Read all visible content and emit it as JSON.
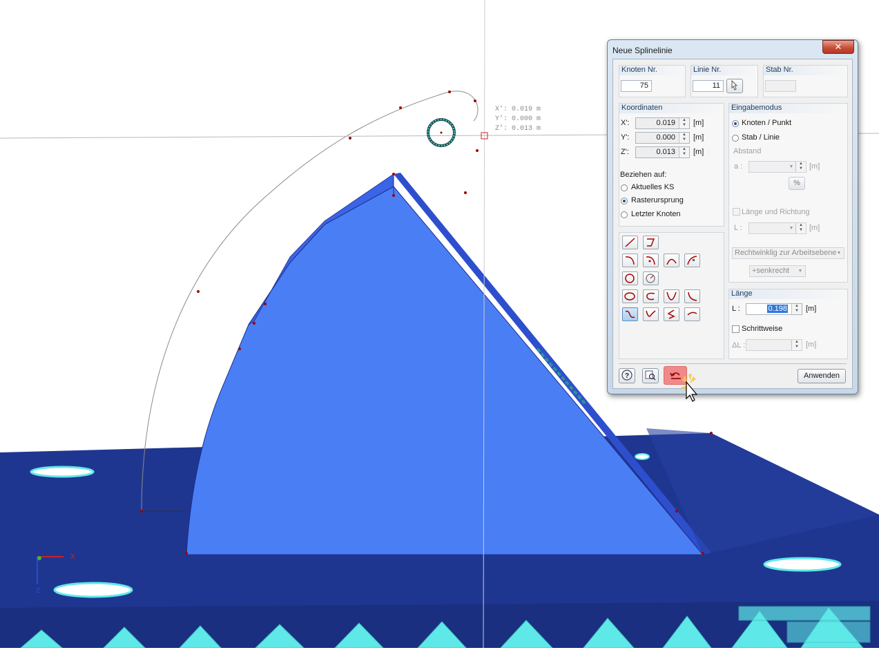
{
  "viewport": {
    "coord_readout": [
      "X': 0.019 m",
      "Y': 0.000 m",
      "Z': 0.013 m"
    ],
    "axis_x_label": "X",
    "axis_z_label": "Z"
  },
  "dialog": {
    "title": "Neue Splinelinie",
    "close_label": "✕",
    "node": {
      "header": "Knoten Nr.",
      "value": "75"
    },
    "line": {
      "header": "Linie Nr.",
      "value": "11"
    },
    "member": {
      "header": "Stab Nr.",
      "value": ""
    },
    "coordinates": {
      "header": "Koordinaten",
      "x_label": "X':",
      "x_value": "0.019",
      "y_label": "Y':",
      "y_value": "0.000",
      "z_label": "Z':",
      "z_value": "0.013",
      "unit": "[m]",
      "relate_label": "Beziehen auf:",
      "options": [
        "Aktuelles KS",
        "Rasterursprung",
        "Letzter Knoten"
      ],
      "selected": "Rasterursprung"
    },
    "input_mode": {
      "header": "Eingabemodus",
      "options": [
        "Knoten / Punkt",
        "Stab / Linie"
      ],
      "selected": "Knoten / Punkt",
      "distance_label": "Abstand",
      "a_label": "a :",
      "a_unit": "[m]",
      "percent_label": "%",
      "length_direction_label": "Länge und Richtung",
      "l_label": "L :",
      "l_unit": "[m]",
      "perpendicular_option": "Rechtwinklig zur Arbeitsebene",
      "direction_option": "+senkrecht"
    },
    "length": {
      "header": "Länge",
      "l_label": "L :",
      "l_value": "0.198",
      "unit": "[m]",
      "stepwise_label": "Schrittweise",
      "delta_label": "ΔL :",
      "delta_unit": "[m]"
    },
    "apply_label": "Anwenden"
  },
  "colors": {
    "plate": "#1f3691",
    "solid_face": "#4a7ef5",
    "solid_top": "#2f4fce",
    "support": "#5fe8e8",
    "dialog_frame": "#c9d9ea",
    "highlight": "#f08080"
  }
}
